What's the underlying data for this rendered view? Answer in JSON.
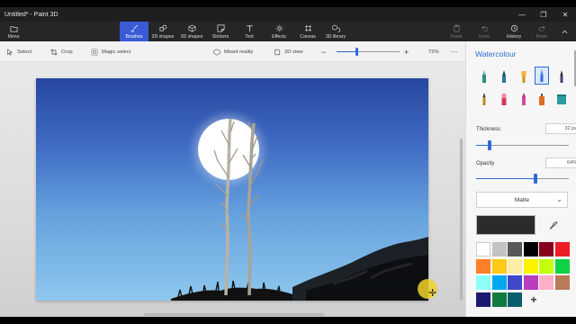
{
  "window": {
    "title": "Untitled* - Paint 3D",
    "minimize": "—",
    "maximize": "❐",
    "close": "✕"
  },
  "toolbar": {
    "menu": "Menu",
    "tools": [
      "Brushes",
      "2D shapes",
      "3D shapes",
      "Stickers",
      "Text",
      "Effects",
      "Canvas",
      "3D library"
    ],
    "right": [
      "Paste",
      "Undo",
      "History",
      "Redo"
    ]
  },
  "cmdbar": {
    "select": "Select",
    "crop": "Crop",
    "magic_select": "Magic select",
    "mixed_reality": "Mixed reality",
    "view_3d": "3D view",
    "zoom_minus": "−",
    "zoom_plus": "+",
    "zoom_level": "72%",
    "zoom_fraction": 0.33,
    "more": "···"
  },
  "panel": {
    "title": "Watercolour",
    "brushes": [
      "marker",
      "calligraphy-pen",
      "oil-brush",
      "watercolour",
      "pixel-pen",
      "pencil",
      "eraser",
      "crayon",
      "spray-can",
      "fill"
    ],
    "selected_brush": 3,
    "thickness_label": "Thickness",
    "thickness_value": "32 px",
    "thickness_fraction": 0.15,
    "opacity_label": "Opacity",
    "opacity_value": "64%",
    "opacity_fraction": 0.64,
    "finish": "Matte",
    "current_color": "#2b2b2b",
    "palette": [
      "#ffffff",
      "#c3c3c3",
      "#585858",
      "#000000",
      "#88001b",
      "#ec1c24",
      "#ff7f27",
      "#ffca18",
      "#fdeca6",
      "#fff200",
      "#c4ff0e",
      "#0ed145",
      "#8cfffb",
      "#00a8f3",
      "#3f48cc",
      "#b83dba",
      "#ffaec8",
      "#b97a56",
      "#1c1a6e",
      "#117a3d",
      "#0a5e6e"
    ],
    "add_color": "+"
  },
  "colors": {
    "accent": "#3b5bd6",
    "toolbar_bg": "#262626",
    "panel_title": "#2a6fd6"
  }
}
